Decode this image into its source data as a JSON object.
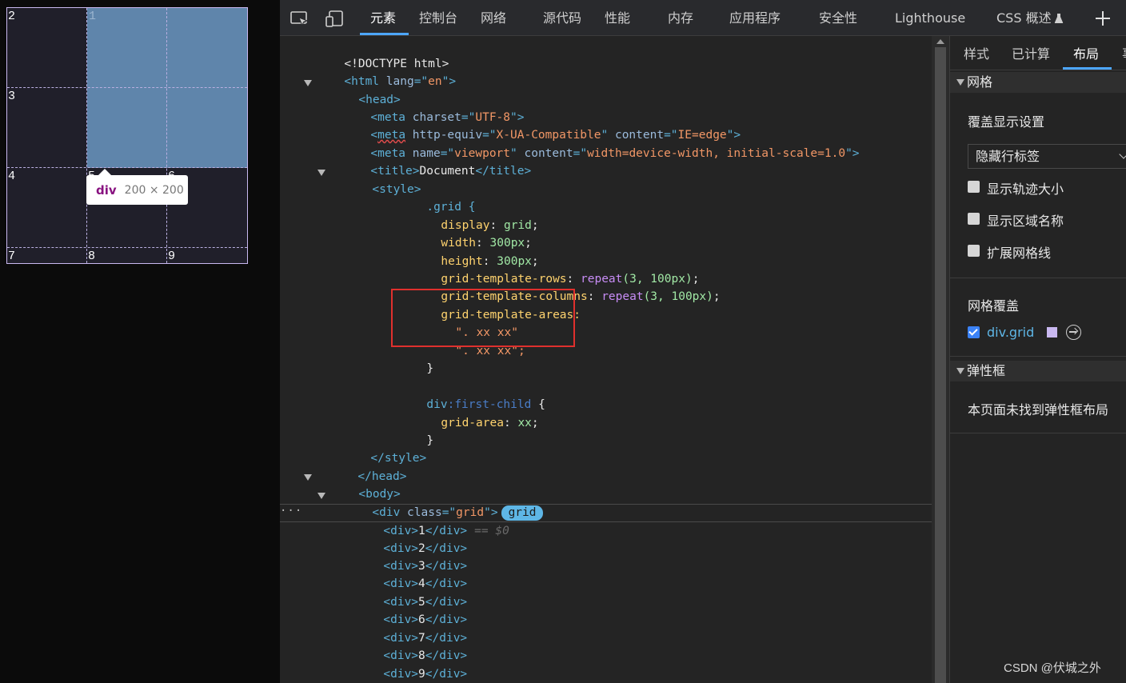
{
  "preview": {
    "highlight_number": "1",
    "grid_numbers": [
      "2",
      "3",
      "4",
      "5",
      "6",
      "7",
      "8",
      "9"
    ],
    "tooltip": {
      "tag": "div",
      "size": "200 × 200"
    }
  },
  "devtools": {
    "tabs": [
      "元素",
      "控制台",
      "网络",
      "源代码",
      "性能",
      "内存",
      "应用程序",
      "安全性",
      "Lighthouse",
      "CSS 概述"
    ],
    "active_tab": "元素",
    "add_tab_icon": "plus-icon",
    "inspect_icon": "inspect-element-icon",
    "device_icon": "device-toolbar-icon",
    "experiment_icon": "flask-icon"
  },
  "code": {
    "doctype": "<!DOCTYPE html>",
    "html_open": [
      "<html",
      " lang",
      "=\"",
      "en",
      "\">"
    ],
    "head_open": "<head>",
    "meta1": {
      "tag": "<meta",
      "attr": " charset",
      "val": "UTF-8",
      "end": "\">"
    },
    "meta2": {
      "tag_open": "<",
      "tag": "meta",
      "attr1": " http-equiv",
      "val1": "X-UA-Compatible",
      "attr2": " content",
      "val2": "IE=edge",
      "end": "\">"
    },
    "meta3": {
      "tag": "<meta",
      "attr1": " name",
      "val1": "viewport",
      "attr2": " content",
      "val2": "width=device-width, initial-scale=1.0",
      "end": "\">"
    },
    "title": {
      "open": "<title>",
      "text": "Document",
      "close": "</title>"
    },
    "style_open": "<style>",
    "css_grid_selector": ".grid {",
    "css": [
      {
        "prop": "display",
        "value": "grid"
      },
      {
        "prop": "width",
        "value": "300px"
      },
      {
        "prop": "height",
        "value": "300px"
      },
      {
        "prop": "grid-template-rows",
        "fn": "repeat",
        "args": "(3, 100px)"
      },
      {
        "prop": "grid-template-columns",
        "fn": "repeat",
        "args": "(3, 100px)"
      }
    ],
    "areas_prop": "grid-template-areas:",
    "areas_lines": [
      "\". xx xx\"",
      "\". xx xx\";"
    ],
    "close_brace": "}",
    "first_child_selector": "div",
    "first_child_pseudo": ":first-child",
    "first_child_brace": " {",
    "grid_area": {
      "prop": "grid-area",
      "value": "xx"
    },
    "style_close": "</style>",
    "head_close": "</head>",
    "body_open": "<body>",
    "div_grid_open": [
      "<div",
      " class",
      "=\"",
      "grid",
      "\">"
    ],
    "grid_badge": "grid",
    "selected_suffix": "== $0",
    "children": [
      "1",
      "2",
      "3",
      "4",
      "5",
      "6",
      "7",
      "8",
      "9"
    ],
    "div_close": "</div>",
    "more_dots": "···"
  },
  "side": {
    "tabs": [
      "样式",
      "已计算",
      "布局",
      "事"
    ],
    "active_tab": "布局",
    "grid_section": "网格",
    "overlay_settings": "覆盖显示设置",
    "select_value": "隐藏行标签",
    "checkboxes": [
      {
        "label": "显示轨迹大小",
        "checked": false
      },
      {
        "label": "显示区域名称",
        "checked": false
      },
      {
        "label": "扩展网格线",
        "checked": false
      }
    ],
    "grid_overlays": "网格覆盖",
    "grid_overlay_item": {
      "label": "div.grid",
      "checked": true,
      "color": "#c9b8f0"
    },
    "flex_section": "弹性框",
    "flex_empty": "本页面未找到弹性框布局"
  },
  "watermark": "CSDN @伏城之外"
}
